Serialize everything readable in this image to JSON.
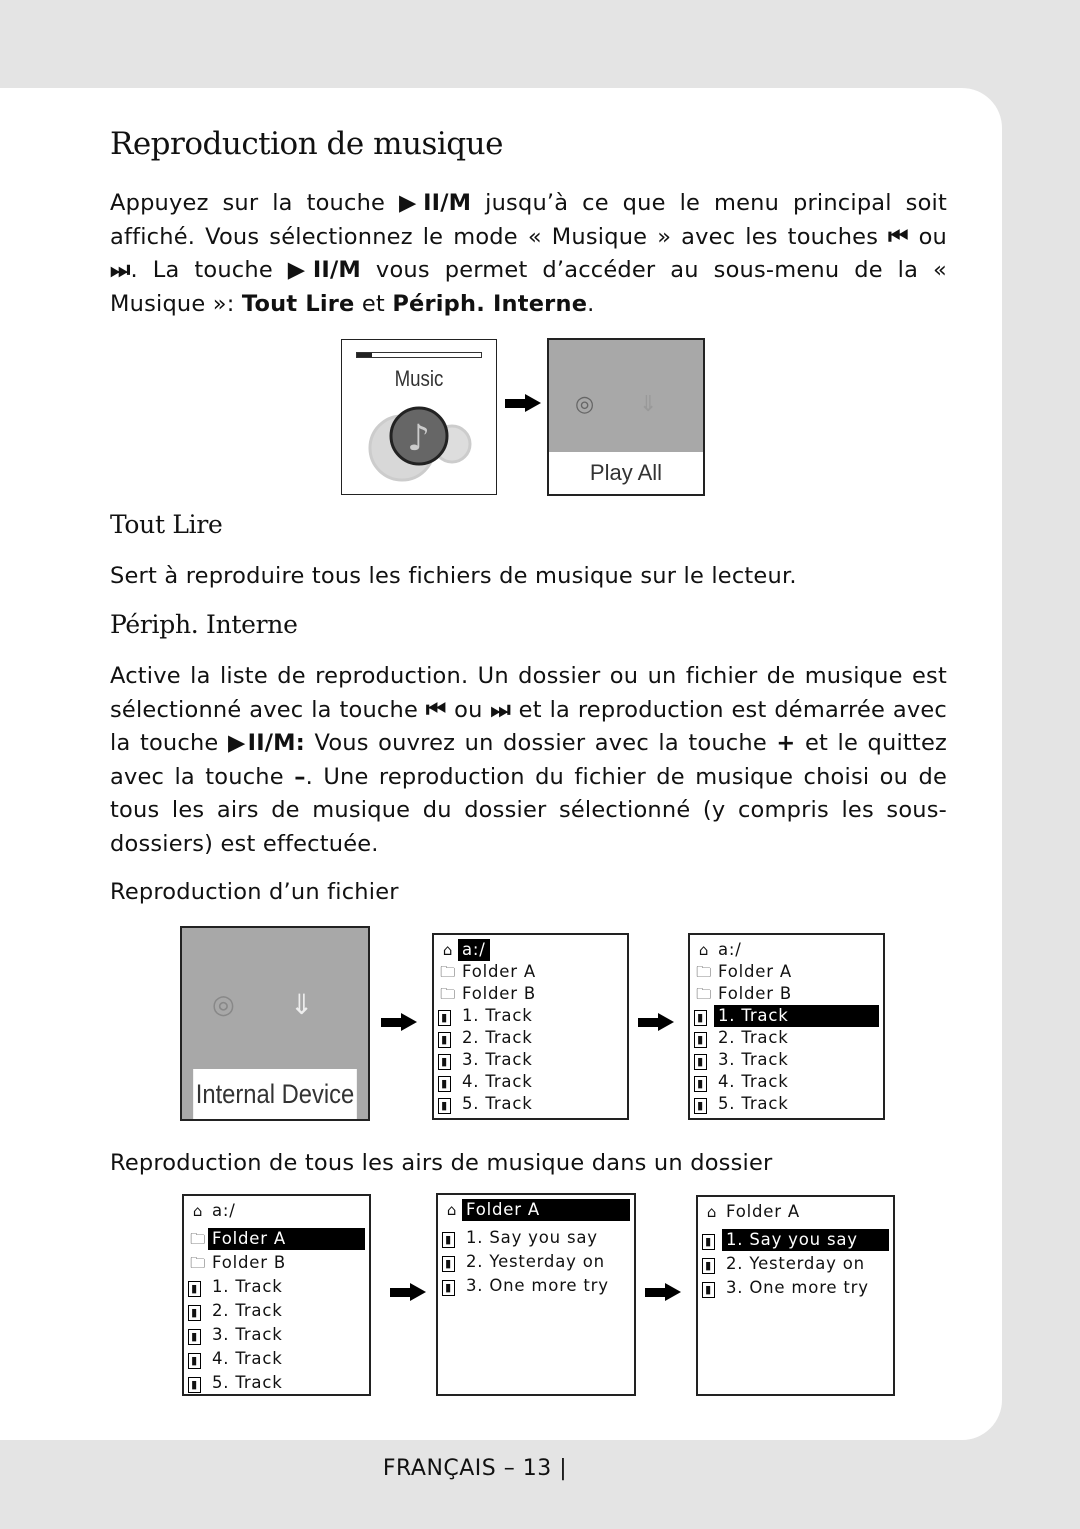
{
  "title": "Reproduction de musique",
  "intro": {
    "parts": [
      "Appuyez sur la touche ",
      "▶II/M",
      " jusqu’à ce que le menu principal soit affiché. Vous sélectionnez le mode « Musique » avec les touches ",
      "⏮",
      " ou ",
      "⏭",
      ". La touche ",
      "▶II/M",
      " vous permet d’accéder au sous-menu de la « Musique »: ",
      "Tout Lire",
      " et ",
      "Périph. Interne",
      "."
    ]
  },
  "fig1": {
    "music_label": "Music",
    "progress": 0.12,
    "play_all_label": "Play All"
  },
  "section1": {
    "heading": "Tout Lire",
    "text": "Sert à reproduire tous les fichiers de musique sur le lecteur."
  },
  "section2": {
    "heading": "Périph. Interne",
    "parts": [
      "Active la liste de reproduction. Un dossier ou un fichier de musique est sélectionné avec la touche ",
      "⏮",
      " ou ",
      "⏭",
      " et la reproduction est démarrée avec la touche ",
      "▶II/M:",
      " Vous ouvrez un dossier avec la touche ",
      "+",
      " et le quittez avec la touche ",
      "–",
      ". Une reproduction du fichier de musique choisi ou de tous les airs de musique du dossier sélectionné (y compris les sous-dossiers) est effectuée."
    ]
  },
  "caption1": "Reproduction d’un fichier",
  "internal_device_label": "Internal Device",
  "caption2": "Reproduction de tous les airs de musique dans un dossier",
  "screens": [
    {
      "rows": [
        {
          "icon": "home",
          "text": "a:/",
          "sel": true
        },
        {
          "icon": "folder",
          "text": "Folder A"
        },
        {
          "icon": "folder",
          "text": "Folder B"
        },
        {
          "icon": "file",
          "text": "1. Track"
        },
        {
          "icon": "file",
          "text": "2. Track"
        },
        {
          "icon": "file",
          "text": "3. Track"
        },
        {
          "icon": "file",
          "text": "4. Track"
        },
        {
          "icon": "file",
          "text": "5. Track"
        }
      ]
    },
    {
      "rows": [
        {
          "icon": "home",
          "text": "a:/"
        },
        {
          "icon": "folder",
          "text": "Folder A"
        },
        {
          "icon": "folder",
          "text": "Folder B"
        },
        {
          "icon": "file",
          "text": "1. Track",
          "sel": true
        },
        {
          "icon": "file",
          "text": "2. Track"
        },
        {
          "icon": "file",
          "text": "3. Track"
        },
        {
          "icon": "file",
          "text": "4. Track"
        },
        {
          "icon": "file",
          "text": "5. Track"
        }
      ]
    },
    {
      "rows": [
        {
          "icon": "home",
          "text": "a:/"
        },
        {
          "icon": "folder",
          "text": "Folder A",
          "sel": true
        },
        {
          "icon": "folder",
          "text": "Folder B"
        },
        {
          "icon": "file",
          "text": "1. Track"
        },
        {
          "icon": "file",
          "text": "2. Track"
        },
        {
          "icon": "file",
          "text": "3. Track"
        },
        {
          "icon": "file",
          "text": "4. Track"
        },
        {
          "icon": "file",
          "text": "5. Track"
        }
      ]
    },
    {
      "rows": [
        {
          "icon": "home",
          "text": "Folder A",
          "sel": true
        },
        {
          "icon": "file",
          "text": "1. Say you say"
        },
        {
          "icon": "file",
          "text": "2. Yesterday on"
        },
        {
          "icon": "file",
          "text": "3. One more try"
        }
      ]
    },
    {
      "rows": [
        {
          "icon": "home",
          "text": "Folder A"
        },
        {
          "icon": "file",
          "text": "1. Say you say",
          "sel": true
        },
        {
          "icon": "file",
          "text": "2. Yesterday on"
        },
        {
          "icon": "file",
          "text": "3. One more try"
        }
      ]
    }
  ],
  "footer": "FRANÇAIS – 13  |"
}
